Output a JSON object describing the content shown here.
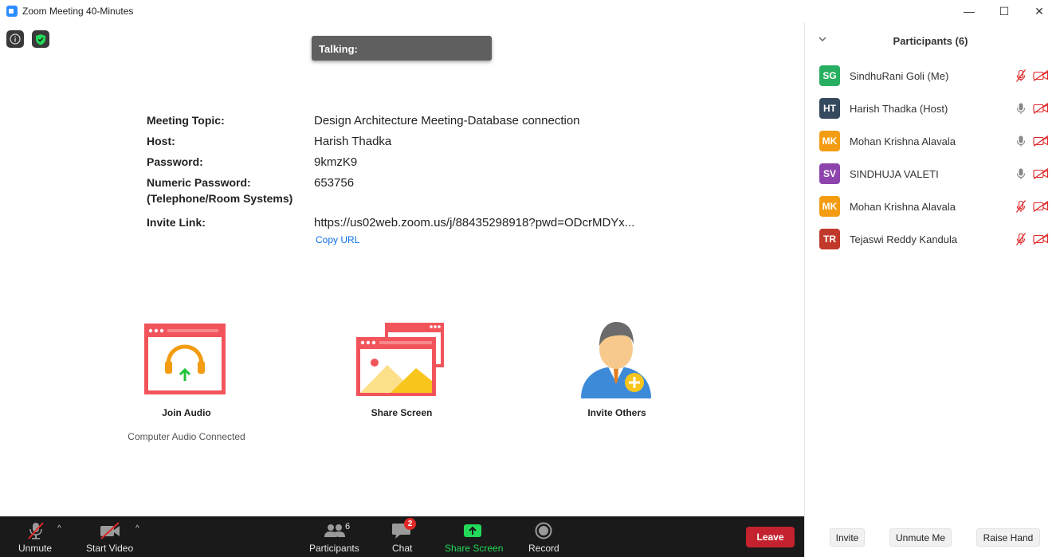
{
  "window": {
    "title": "Zoom Meeting 40-Minutes",
    "minimize": "—",
    "maximize": "☐",
    "close": "✕"
  },
  "talking": {
    "label": "Talking:"
  },
  "meeting_info": {
    "topic_label": "Meeting Topic:",
    "topic_value": "Design Architecture Meeting-Database connection",
    "host_label": "Host:",
    "host_value": "Harish Thadka",
    "password_label": "Password:",
    "password_value": "9kmzK9",
    "numeric_password_label_1": "Numeric Password:",
    "numeric_password_label_2": "(Telephone/Room Systems)",
    "numeric_password_value": "653756",
    "invite_link_label": "Invite Link:",
    "invite_link_value": "https://us02web.zoom.us/j/88435298918?pwd=ODcrMDYx...",
    "copy_url": "Copy URL"
  },
  "actions": {
    "join_audio": "Join Audio",
    "join_audio_sub": "Computer Audio Connected",
    "share_screen": "Share Screen",
    "invite_others": "Invite Others"
  },
  "participants_panel": {
    "title": "Participants (6)",
    "participants": [
      {
        "initials": "SG",
        "name": "SindhuRani Goli (Me)",
        "color": "#27ae60",
        "mic_muted": true,
        "video_off": true
      },
      {
        "initials": "HT",
        "name": "Harish Thadka (Host)",
        "color": "#34495e",
        "mic_muted": false,
        "video_off": true
      },
      {
        "initials": "MK",
        "name": "Mohan Krishna Alavala",
        "color": "#f39c12",
        "mic_muted": false,
        "video_off": true
      },
      {
        "initials": "SV",
        "name": "SINDHUJA VALETI",
        "color": "#8e44ad",
        "mic_muted": false,
        "video_off": true
      },
      {
        "initials": "MK",
        "name": "Mohan Krishna Alavala",
        "color": "#f39c12",
        "mic_muted": true,
        "video_off": true
      },
      {
        "initials": "TR",
        "name": "Tejaswi Reddy Kandula",
        "color": "#c0392b",
        "mic_muted": true,
        "video_off": true
      }
    ],
    "invite": "Invite",
    "unmute_me": "Unmute Me",
    "raise_hand": "Raise Hand"
  },
  "toolbar": {
    "unmute": "Unmute",
    "start_video": "Start Video",
    "participants": "Participants",
    "participants_count": "6",
    "chat": "Chat",
    "chat_badge": "2",
    "share_screen": "Share Screen",
    "record": "Record",
    "leave": "Leave"
  },
  "colors": {
    "accent_blue": "#0e71eb",
    "share_green": "#23d959",
    "leave_red": "#c4222e",
    "tile_red": "#f2545b"
  }
}
